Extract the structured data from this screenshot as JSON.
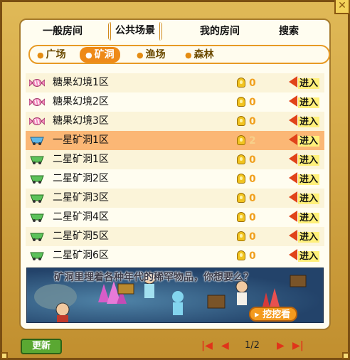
{
  "main_tabs": [
    {
      "label": "一般房间"
    },
    {
      "label": "公共场景"
    },
    {
      "label": "我的房间"
    },
    {
      "label": "搜索"
    }
  ],
  "sub_tabs": [
    {
      "label": "广场"
    },
    {
      "label": "矿洞"
    },
    {
      "label": "渔场"
    },
    {
      "label": "森林"
    }
  ],
  "rooms": [
    {
      "name": "糖果幻境1区",
      "count": "0",
      "icon": "candy-icon",
      "enter": "进入"
    },
    {
      "name": "糖果幻境2区",
      "count": "0",
      "icon": "candy-icon",
      "enter": "进入"
    },
    {
      "name": "糖果幻境3区",
      "count": "0",
      "icon": "candy-icon",
      "enter": "进入"
    },
    {
      "name": "一星矿洞1区",
      "count": "2",
      "icon": "mine-cart-blue-icon",
      "enter": "进入"
    },
    {
      "name": "二星矿洞1区",
      "count": "0",
      "icon": "mine-cart-green-icon",
      "enter": "进入"
    },
    {
      "name": "二星矿洞2区",
      "count": "0",
      "icon": "mine-cart-green-icon",
      "enter": "进入"
    },
    {
      "name": "二星矿洞3区",
      "count": "0",
      "icon": "mine-cart-green-icon",
      "enter": "进入"
    },
    {
      "name": "二星矿洞4区",
      "count": "0",
      "icon": "mine-cart-green-icon",
      "enter": "进入"
    },
    {
      "name": "二星矿洞5区",
      "count": "0",
      "icon": "mine-cart-green-icon",
      "enter": "进入"
    },
    {
      "name": "二星矿洞6区",
      "count": "0",
      "icon": "mine-cart-green-icon",
      "enter": "进入"
    }
  ],
  "banner": {
    "title": "矿洞里埋着各种年代的稀罕物品，你想要么？",
    "dig_label": "挖挖看"
  },
  "footer": {
    "refresh_label": "更新",
    "page": "1/2"
  },
  "colors": {
    "accent": "#ee8a18",
    "selected_row": "#fbb775",
    "count": "#f0a020",
    "enter_arrow": "#e0431a",
    "refresh": "#5aa832"
  }
}
